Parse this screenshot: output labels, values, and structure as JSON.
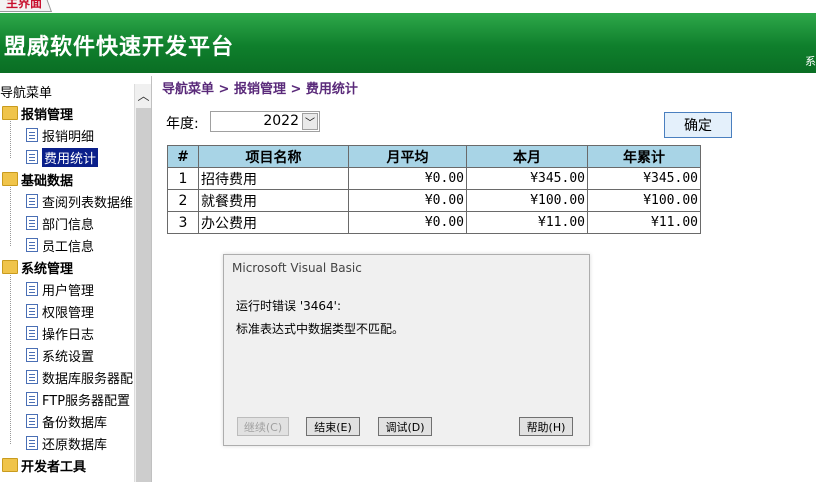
{
  "tab": {
    "label": "主界面"
  },
  "banner": {
    "title": "盟威软件快速开发平台",
    "right_text": "系"
  },
  "sidebar": {
    "root": "导航菜单",
    "items": [
      {
        "label": "报销管理",
        "group": true,
        "icon": "folder-open-icon"
      },
      {
        "label": "报销明细",
        "group": false,
        "icon": "document-icon"
      },
      {
        "label": "费用统计",
        "group": false,
        "icon": "document-icon",
        "selected": true
      },
      {
        "label": "基础数据",
        "group": true,
        "icon": "folder-open-icon"
      },
      {
        "label": "查阅列表数据维",
        "group": false,
        "icon": "grid-icon"
      },
      {
        "label": "部门信息",
        "group": false,
        "icon": "document-icon"
      },
      {
        "label": "员工信息",
        "group": false,
        "icon": "document-icon"
      },
      {
        "label": "系统管理",
        "group": true,
        "icon": "folder-open-icon"
      },
      {
        "label": "用户管理",
        "group": false,
        "icon": "users-icon"
      },
      {
        "label": "权限管理",
        "group": false,
        "icon": "lock-icon"
      },
      {
        "label": "操作日志",
        "group": false,
        "icon": "document-icon"
      },
      {
        "label": "系统设置",
        "group": false,
        "icon": "settings-doc-icon"
      },
      {
        "label": "数据库服务器配",
        "group": false,
        "icon": "database-icon"
      },
      {
        "label": "FTP服务器配置",
        "group": false,
        "icon": "document-icon"
      },
      {
        "label": "备份数据库",
        "group": false,
        "icon": "database-icon"
      },
      {
        "label": "还原数据库",
        "group": false,
        "icon": "database-icon"
      },
      {
        "label": "开发者工具",
        "group": true,
        "icon": "folder-open-icon"
      }
    ]
  },
  "breadcrumb": "导航菜单 > 报销管理 > 费用统计",
  "filter": {
    "year_label": "年度:",
    "year_value": "2022",
    "ok_label": "确定"
  },
  "table": {
    "headers": [
      "#",
      "项目名称",
      "月平均",
      "本月",
      "年累计"
    ],
    "rows": [
      [
        "1",
        "招待费用",
        "¥0.00",
        "¥345.00",
        "¥345.00"
      ],
      [
        "2",
        "就餐费用",
        "¥0.00",
        "¥100.00",
        "¥100.00"
      ],
      [
        "3",
        "办公费用",
        "¥0.00",
        "¥11.00",
        "¥11.00"
      ]
    ]
  },
  "dialog": {
    "title": "Microsoft Visual Basic",
    "line1": "运行时错误 '3464':",
    "line2": "标准表达式中数据类型不匹配。",
    "buttons": {
      "continue": "继续(C)",
      "end": "结束(E)",
      "debug": "调试(D)",
      "help": "帮助(H)"
    }
  },
  "colors": {
    "banner_green": "#0f7f2c",
    "table_header": "#a8d4e6",
    "selected": "#0a1f8a",
    "breadcrumb": "#5a2a7a"
  }
}
